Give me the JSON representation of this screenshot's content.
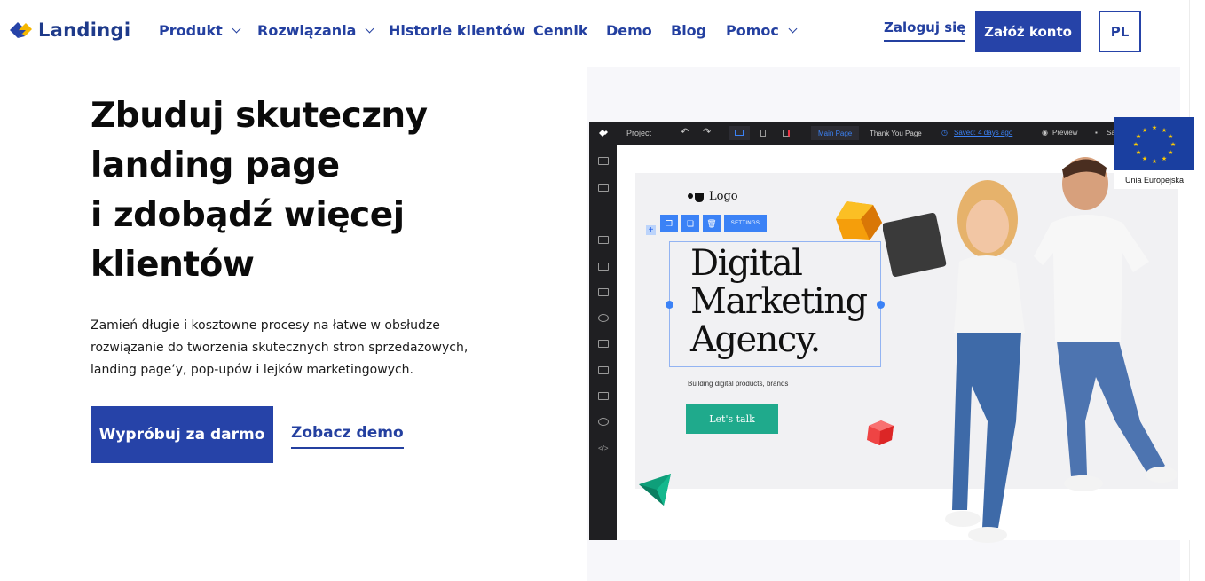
{
  "brand": {
    "name": "Landingi",
    "colors": {
      "primary": "#2643a8",
      "accent_yellow": "#f5b700",
      "teal": "#1faa8c"
    }
  },
  "nav": {
    "items": [
      {
        "label": "Produkt",
        "dropdown": true
      },
      {
        "label": "Rozwiązania",
        "dropdown": true
      },
      {
        "label": "Historie klientów",
        "dropdown": false
      },
      {
        "label": "Cennik",
        "dropdown": false
      },
      {
        "label": "Demo",
        "dropdown": false
      },
      {
        "label": "Blog",
        "dropdown": false
      },
      {
        "label": "Pomoc",
        "dropdown": true
      }
    ],
    "login": "Zaloguj się",
    "signup": "Załóż konto",
    "lang": "PL"
  },
  "hero": {
    "title_1": "Zbuduj ",
    "title_1_bold": "skuteczny",
    "title_2_bold": "landing page",
    "title_3": "i zdobądź ",
    "title_3_bold": "więcej",
    "title_4_bold": "klientów",
    "description": "Zamień długie i kosztowne procesy na łatwe w obsłudze rozwiązanie do tworzenia skutecznych stron sprzedażowych, landing page’y, pop-upów i lejków marketingowych.",
    "cta_primary": "Wypróbuj za darmo",
    "cta_secondary": "Zobacz demo"
  },
  "editor": {
    "project": "Project",
    "tab_main": "Main Page",
    "tab_thanks": "Thank You Page",
    "saved": "Saved: 4 days ago",
    "preview": "Preview",
    "save_short": "Sa",
    "settings": "SETTINGS",
    "canvas_logo": "Logo",
    "headline_1": "Digital",
    "headline_2": "Marketing",
    "headline_3": "Agency.",
    "subline": "Building digital products, brands",
    "button": "Let's talk"
  },
  "eu": {
    "label": "Unia Europejska"
  }
}
